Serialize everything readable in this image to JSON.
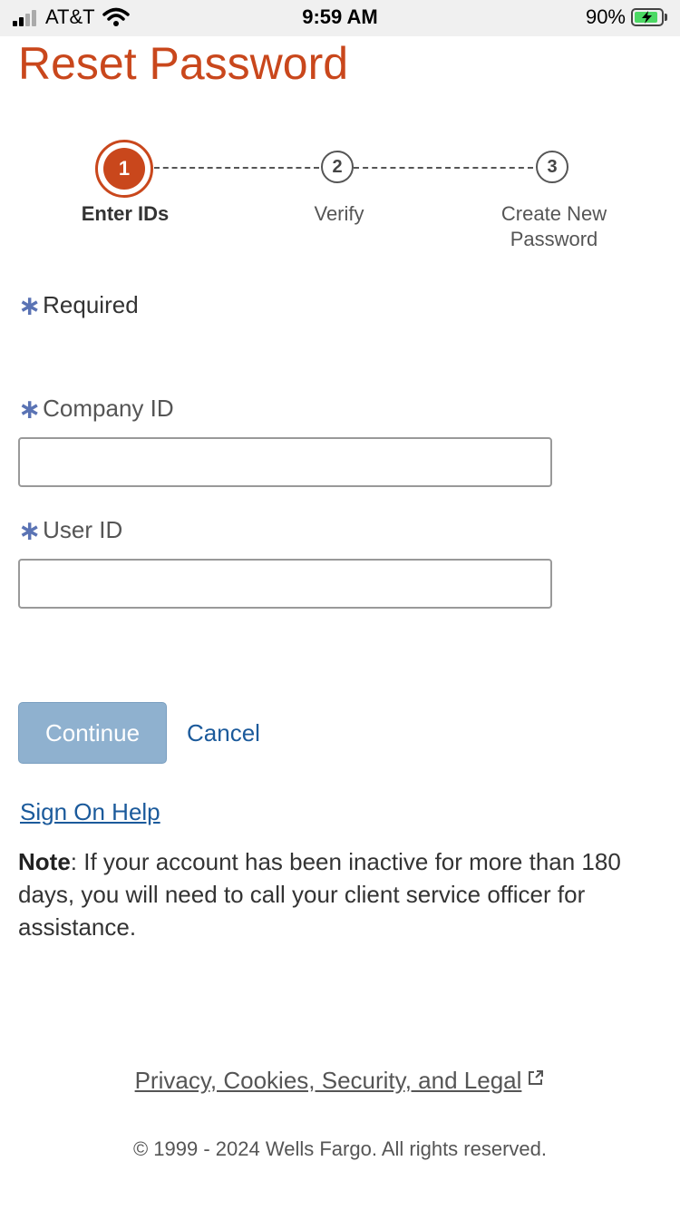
{
  "status_bar": {
    "carrier": "AT&T",
    "time": "9:59 AM",
    "battery": "90%"
  },
  "page": {
    "title": "Reset Password"
  },
  "stepper": {
    "steps": [
      {
        "number": "1",
        "label": "Enter IDs",
        "active": true
      },
      {
        "number": "2",
        "label": "Verify",
        "active": false
      },
      {
        "number": "3",
        "label_line1": "Create New",
        "label_line2": "Password",
        "active": false
      }
    ]
  },
  "form": {
    "asterisk": "∗",
    "required_label": "Required",
    "company_id_label": "Company ID",
    "company_id_value": "",
    "user_id_label": "User ID",
    "user_id_value": "",
    "continue_label": "Continue",
    "cancel_label": "Cancel"
  },
  "help": {
    "sign_on_help": "Sign On Help",
    "note_label": "Note",
    "note_text": ": If your account has been inactive for more than 180 days, you will need to call your client service officer for assistance."
  },
  "footer": {
    "legal_link": "Privacy, Cookies, Security, and Legal",
    "copyright": "© 1999 - 2024 Wells Fargo. All rights reserved."
  },
  "colors": {
    "brand": "#c9471c",
    "link": "#1b5a9b",
    "asterisk": "#5a73b4",
    "button_disabled": "#8fb1cf"
  }
}
